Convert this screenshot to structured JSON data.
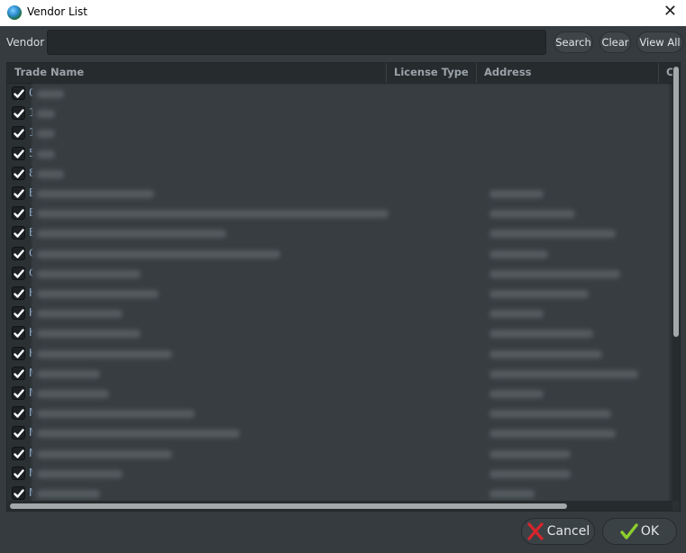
{
  "window": {
    "title": "Vendor List",
    "close_label": "✕"
  },
  "search": {
    "label": "Vendor",
    "value": "",
    "placeholder": ""
  },
  "toolbar": {
    "search_label": "Search",
    "clear_label": "Clear",
    "view_all_label": "View All"
  },
  "table": {
    "columns": [
      "Trade Name",
      "License Type",
      "Address",
      "C"
    ],
    "rows": [
      {
        "checked": true,
        "initial": "0"
      },
      {
        "checked": true,
        "initial": "1"
      },
      {
        "checked": true,
        "initial": "1"
      },
      {
        "checked": true,
        "initial": "5"
      },
      {
        "checked": true,
        "initial": "8"
      },
      {
        "checked": true,
        "initial": "B"
      },
      {
        "checked": true,
        "initial": "B"
      },
      {
        "checked": true,
        "initial": "B"
      },
      {
        "checked": true,
        "initial": "C"
      },
      {
        "checked": true,
        "initial": "C"
      },
      {
        "checked": true,
        "initial": "H"
      },
      {
        "checked": true,
        "initial": "H"
      },
      {
        "checked": true,
        "initial": "H"
      },
      {
        "checked": true,
        "initial": "H"
      },
      {
        "checked": true,
        "initial": "M"
      },
      {
        "checked": true,
        "initial": "M"
      },
      {
        "checked": true,
        "initial": "M"
      },
      {
        "checked": true,
        "initial": "M"
      },
      {
        "checked": true,
        "initial": "M"
      },
      {
        "checked": true,
        "initial": "M"
      },
      {
        "checked": true,
        "initial": "M"
      }
    ],
    "redacted": true
  },
  "footer": {
    "cancel_label": "Cancel",
    "ok_label": "OK"
  },
  "colors": {
    "cancel_icon": "#d9242b",
    "ok_icon": "#8ccf2c"
  }
}
